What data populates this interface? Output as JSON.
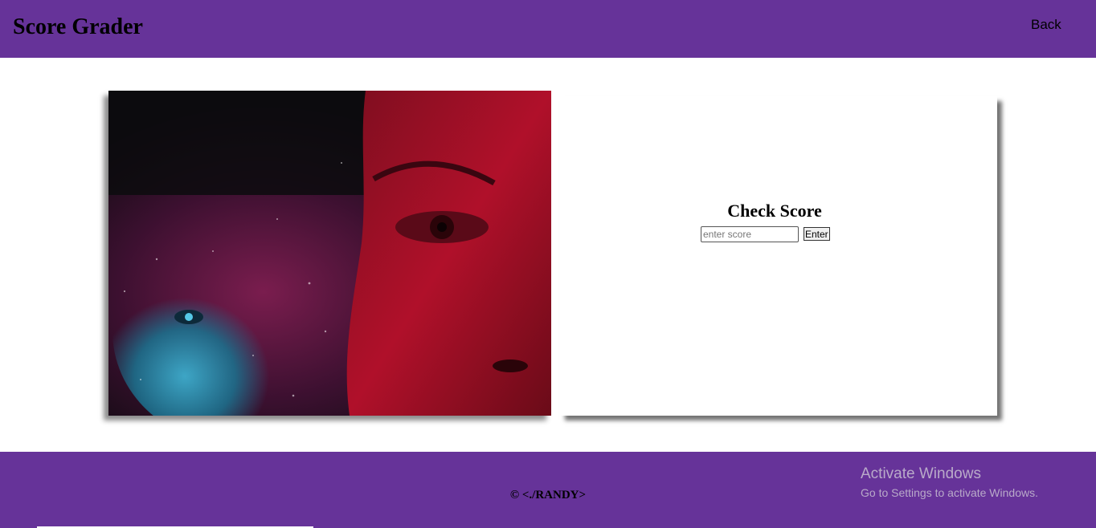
{
  "header": {
    "title": "Score Grader",
    "back_label": "Back"
  },
  "score_card": {
    "heading": "Check Score",
    "input_value": "",
    "input_placeholder": "enter score",
    "button_label": "Enter"
  },
  "footer": {
    "copyright": "© <./RANDY>"
  },
  "os_watermark": {
    "title": "Activate Windows",
    "subtitle": "Go to Settings to activate Windows."
  },
  "colors": {
    "brand_purple": "#663399",
    "watermark_text": "#b9aac9"
  }
}
